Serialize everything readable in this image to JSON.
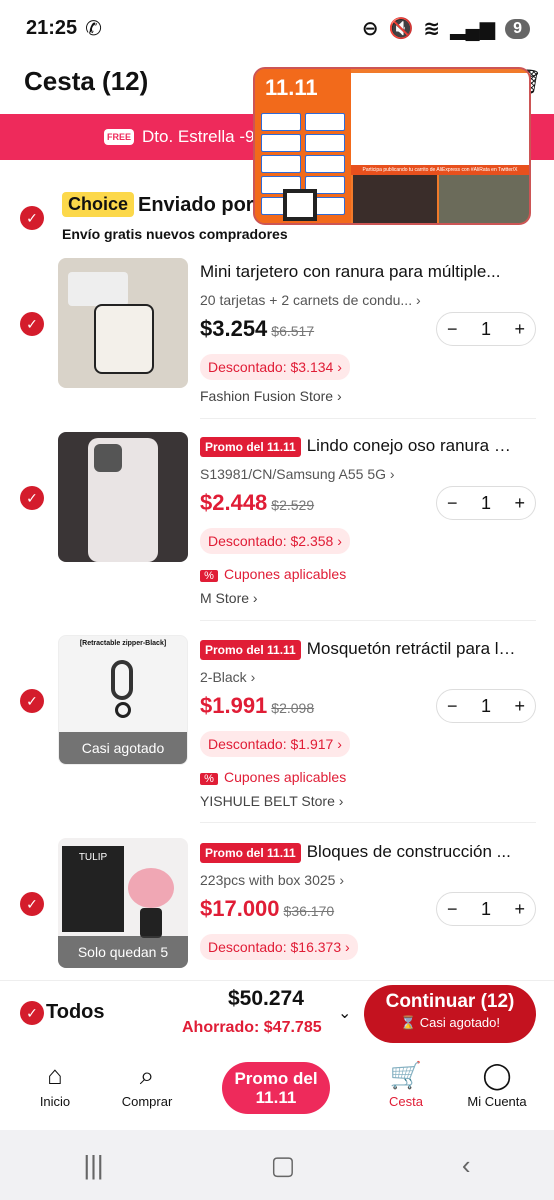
{
  "status": {
    "time": "21:25",
    "battery": "9"
  },
  "header": {
    "title": "Cesta (12)"
  },
  "promo_strip": {
    "free": "FREE",
    "text": "Dto. Estrella -9.5%"
  },
  "overlay": {
    "brand": "11.11",
    "banner": "Participa publicando tu carrito de AliExpress con #AliRata en Twitter/X"
  },
  "section": {
    "badge": "Choice",
    "title": "Enviado por",
    "subtitle": "Envío gratis nuevos compradores"
  },
  "items": [
    {
      "title": "Mini tarjetero con ranura para múltiple...",
      "variant": "20 tarjetas + 2 carnets de condu...",
      "price": "$3.254",
      "old": "$6.517",
      "discount": "Descontado: $3.134",
      "store": "Fashion Fusion Store",
      "qty": "1"
    },
    {
      "promo": "Promo del 11.11",
      "title": "Lindo conejo oso ranura p...",
      "variant": "S13981/CN/Samsung A55 5G",
      "price": "$2.448",
      "old": "$2.529",
      "discount": "Descontado: $2.358",
      "coupon": "Cupones aplicables",
      "store": "M Store",
      "qty": "1"
    },
    {
      "promo": "Promo del 11.11",
      "title": "Mosquetón retráctil para ll...",
      "variant": "2-Black",
      "price": "$1.991",
      "old": "$2.098",
      "discount": "Descontado: $1.917",
      "coupon": "Cupones aplicables",
      "store": "YISHULE BELT Store",
      "qty": "1",
      "thumb_label": "Casi agotado",
      "thumb_text": "[Retractable zipper-Black]"
    },
    {
      "promo": "Promo del 11.11",
      "title": "Bloques de construcción ...",
      "variant": "223pcs with box 3025",
      "price": "$17.000",
      "old": "$36.170",
      "discount": "Descontado: $16.373",
      "qty": "1",
      "thumb_label": "Solo quedan 5",
      "thumb_text": "TULIP"
    }
  ],
  "footer": {
    "all": "Todos",
    "total": "$50.274",
    "saved": "Ahorrado: $47.785",
    "continue": "Continuar (12)",
    "continue_sub": "⌛ Casi agotado!"
  },
  "nav": {
    "inicio": "Inicio",
    "comprar": "Comprar",
    "promo_l1": "Promo del",
    "promo_l2": "11.11",
    "cesta": "Cesta",
    "cuenta": "Mi Cuenta"
  },
  "colors": {
    "accent": "#e01d36",
    "promo": "#ee2a5b"
  }
}
